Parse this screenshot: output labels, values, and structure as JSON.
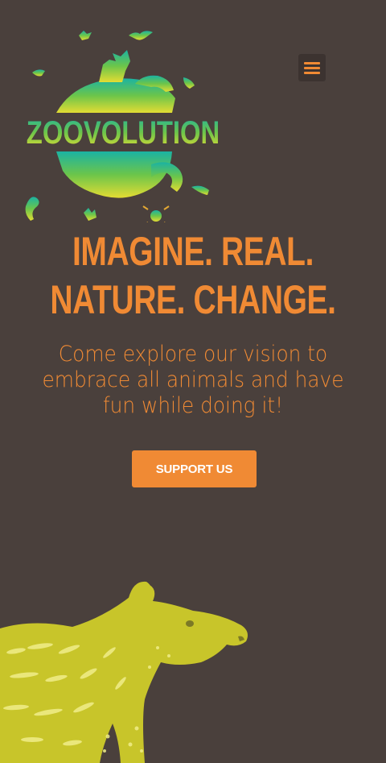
{
  "header": {
    "logo_text": "ZOOVOLUTION",
    "menu_icon": "hamburger-menu-icon"
  },
  "hero": {
    "headline_line1": "IMAGINE. REAL.",
    "headline_line2": "NATURE. CHANGE.",
    "subtitle": "Come explore our vision to embrace all animals and have fun while doing it!",
    "cta_label": "SUPPORT US",
    "illustration_icon": "tapir-illustration"
  },
  "colors": {
    "background": "#4a403c",
    "accent": "#f08a34",
    "button_text": "#ffffff",
    "logo_gradient_top": "#1bb3a2",
    "logo_gradient_bottom": "#e3dc33",
    "tapir": "#c8c52a"
  }
}
